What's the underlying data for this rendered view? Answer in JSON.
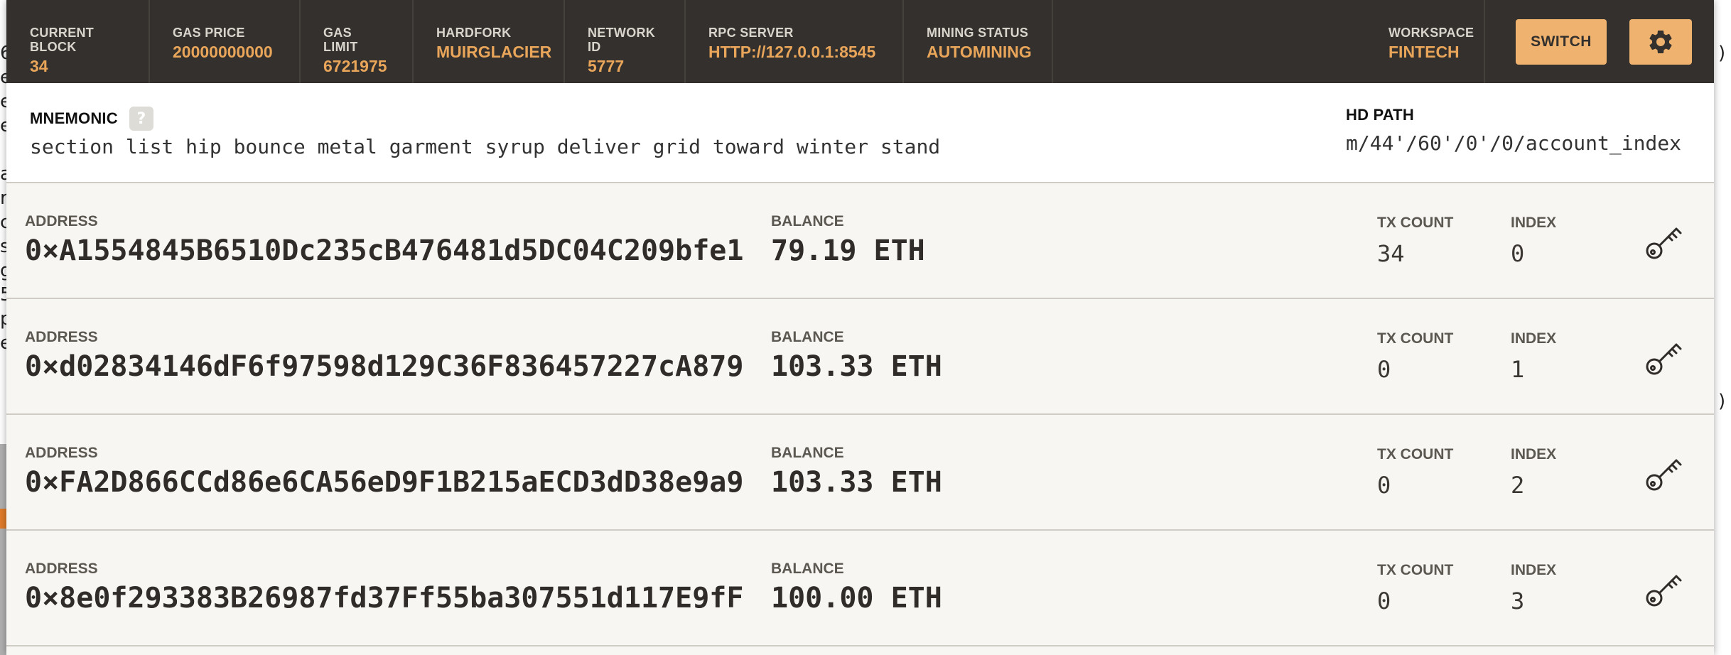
{
  "topbar": {
    "stats": [
      {
        "label": "CURRENT BLOCK",
        "value": "34"
      },
      {
        "label": "GAS PRICE",
        "value": "20000000000"
      },
      {
        "label": "GAS LIMIT",
        "value": "6721975"
      },
      {
        "label": "HARDFORK",
        "value": "MUIRGLACIER"
      },
      {
        "label": "NETWORK ID",
        "value": "5777"
      },
      {
        "label": "RPC SERVER",
        "value": "HTTP://127.0.0.1:8545"
      },
      {
        "label": "MINING STATUS",
        "value": "AUTOMINING"
      }
    ],
    "workspace": {
      "label": "WORKSPACE",
      "value": "FINTECH"
    },
    "switch_label": "SWITCH",
    "settings_icon": "gear-icon"
  },
  "mnemonic": {
    "label": "MNEMONIC",
    "help": "?",
    "words": "section list hip bounce metal garment syrup deliver grid toward winter stand",
    "hd_path_label": "HD PATH",
    "hd_path": "m/44'/60'/0'/0/account_index"
  },
  "accounts": [
    {
      "address_label": "ADDRESS",
      "address": "0×A1554845B6510Dc235cB476481d5DC04C209bfe1",
      "balance_label": "BALANCE",
      "balance": "79.19 ETH",
      "tx_label": "TX COUNT",
      "tx_count": "34",
      "index_label": "INDEX",
      "index": "0"
    },
    {
      "address_label": "ADDRESS",
      "address": "0×d02834146dF6f97598d129C36F836457227cA879",
      "balance_label": "BALANCE",
      "balance": "103.33 ETH",
      "tx_label": "TX COUNT",
      "tx_count": "0",
      "index_label": "INDEX",
      "index": "1"
    },
    {
      "address_label": "ADDRESS",
      "address": "0×FA2D866CCd86e6CA56eD9F1B215aECD3dD38e9a9",
      "balance_label": "BALANCE",
      "balance": "103.33 ETH",
      "tx_label": "TX COUNT",
      "tx_count": "0",
      "index_label": "INDEX",
      "index": "2"
    },
    {
      "address_label": "ADDRESS",
      "address": "0×8e0f293383B26987fd37Ff55ba307551d117E9fF",
      "balance_label": "BALANCE",
      "balance": "100.00 ETH",
      "tx_label": "TX COUNT",
      "tx_count": "0",
      "index_label": "INDEX",
      "index": "3"
    }
  ],
  "background_window": {
    "edge_glyphs": [
      "6",
      "e",
      "e",
      "e",
      "a",
      "r",
      "c",
      "s",
      "g",
      "5",
      "p",
      "e",
      ")",
      ")"
    ]
  },
  "colors": {
    "topbar_bg": "#33302d",
    "accent": "#e9a65a",
    "button_bg": "#efb36f",
    "row_bg": "#f7f6f2"
  }
}
